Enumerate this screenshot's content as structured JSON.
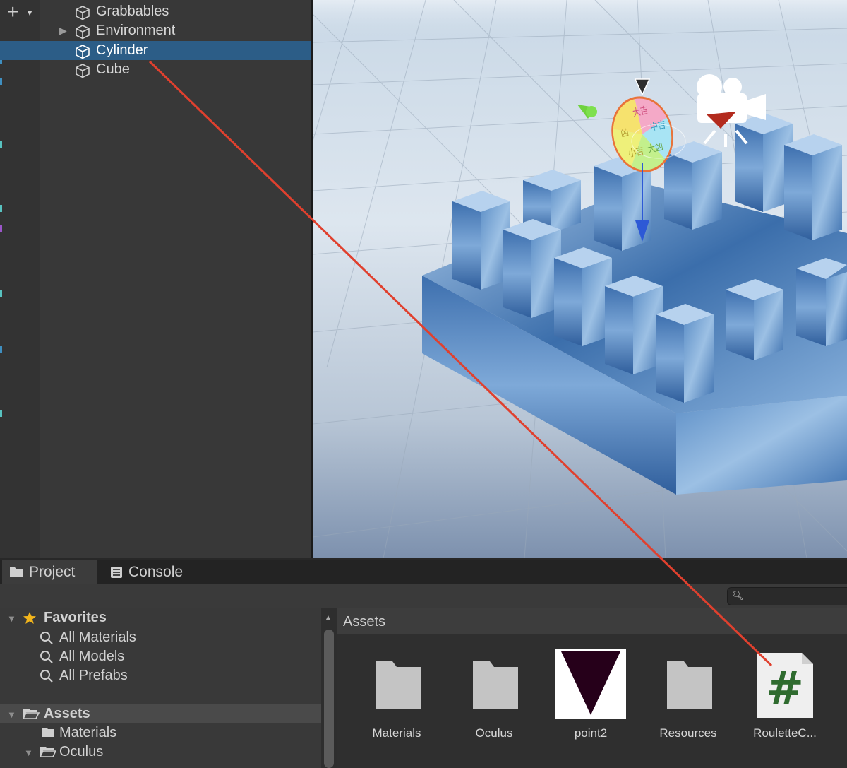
{
  "hierarchy": {
    "items": [
      {
        "label": "Grabbables",
        "expandable": false,
        "selected": false
      },
      {
        "label": "Environment",
        "expandable": true,
        "selected": false
      },
      {
        "label": "Cylinder",
        "expandable": false,
        "selected": true
      },
      {
        "label": "Cube",
        "expandable": false,
        "selected": false
      }
    ]
  },
  "scene": {
    "wheel_segments": [
      "大吉",
      "中吉",
      "大凶",
      "小吉",
      "凶"
    ]
  },
  "tabs": {
    "project": "Project",
    "console": "Console"
  },
  "toolbar": {
    "add_symbol": "+",
    "search_placeholder": ""
  },
  "favorites": {
    "label": "Favorites",
    "items": [
      "All Materials",
      "All Models",
      "All Prefabs"
    ]
  },
  "tree": {
    "assets": "Assets",
    "materials": "Materials",
    "oculus": "Oculus"
  },
  "assets": {
    "header": "Assets",
    "items": [
      {
        "label": "Materials",
        "kind": "folder"
      },
      {
        "label": "Oculus",
        "kind": "folder"
      },
      {
        "label": "point2",
        "kind": "texture"
      },
      {
        "label": "Resources",
        "kind": "folder"
      },
      {
        "label": "RouletteC...",
        "kind": "script",
        "glyph": "#"
      }
    ]
  },
  "colors": {
    "selection": "#2c5d87",
    "connector": "#e0402e",
    "script_glyph": "#2f6b2f"
  }
}
